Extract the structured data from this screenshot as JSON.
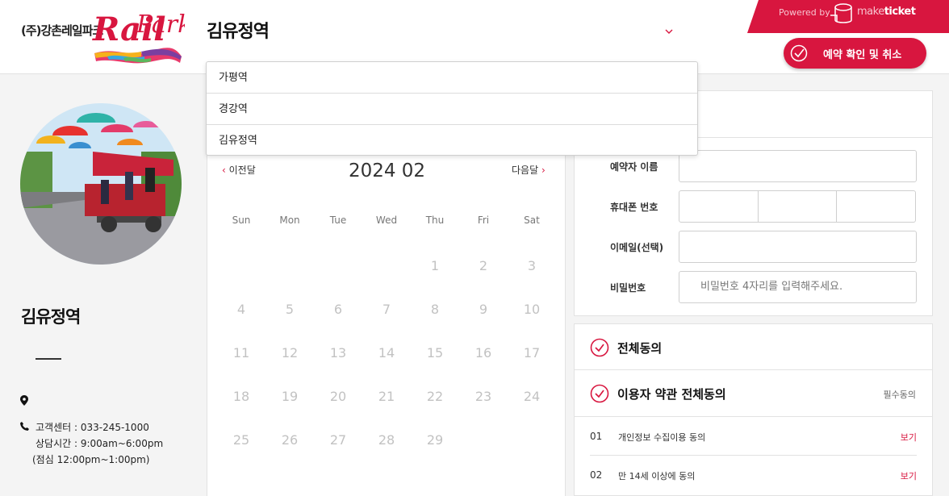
{
  "header": {
    "logo_text": "(주)강촌레일파크",
    "logo_brand": "RailPark",
    "selected_station": "김유정역",
    "powered_by": "Powered by",
    "maketicket_make": "make",
    "maketicket_ticket": "ticket",
    "reserve_button_label": "예약 확인 및 취소"
  },
  "dropdown": {
    "options": [
      "가평역",
      "경강역",
      "김유정역"
    ]
  },
  "station_info": {
    "name": "김유정역",
    "address": "",
    "phone": "고객센터 : 033-245-1000",
    "hours": "상담시간 : 9:00am~6:00pm",
    "lunch": "(점심 12:00pm~1:00pm)"
  },
  "calendar": {
    "prev_label": "이전달",
    "next_label": "다음달",
    "month_title": "2024 02",
    "weekdays": [
      "Sun",
      "Mon",
      "Tue",
      "Wed",
      "Thu",
      "Fri",
      "Sat"
    ],
    "first_weekday_index": 4,
    "days_in_month": 29
  },
  "form": {
    "name_label": "예약자 이름",
    "phone_label": "휴대폰 번호",
    "email_label": "이메일(선택)",
    "password_label": "비밀번호",
    "password_placeholder": "비밀번호 4자리를 입력해주세요."
  },
  "agreement": {
    "all_label": "전체동의",
    "terms_label": "이용자 약관 전체동의",
    "required_label": "필수동의",
    "items": [
      {
        "num": "01",
        "text": "개인정보 수집이용 동의",
        "view": "보기"
      },
      {
        "num": "02",
        "text": "만 14세 이상에 동의",
        "view": "보기"
      }
    ]
  },
  "colors": {
    "accent": "#d8163f"
  }
}
